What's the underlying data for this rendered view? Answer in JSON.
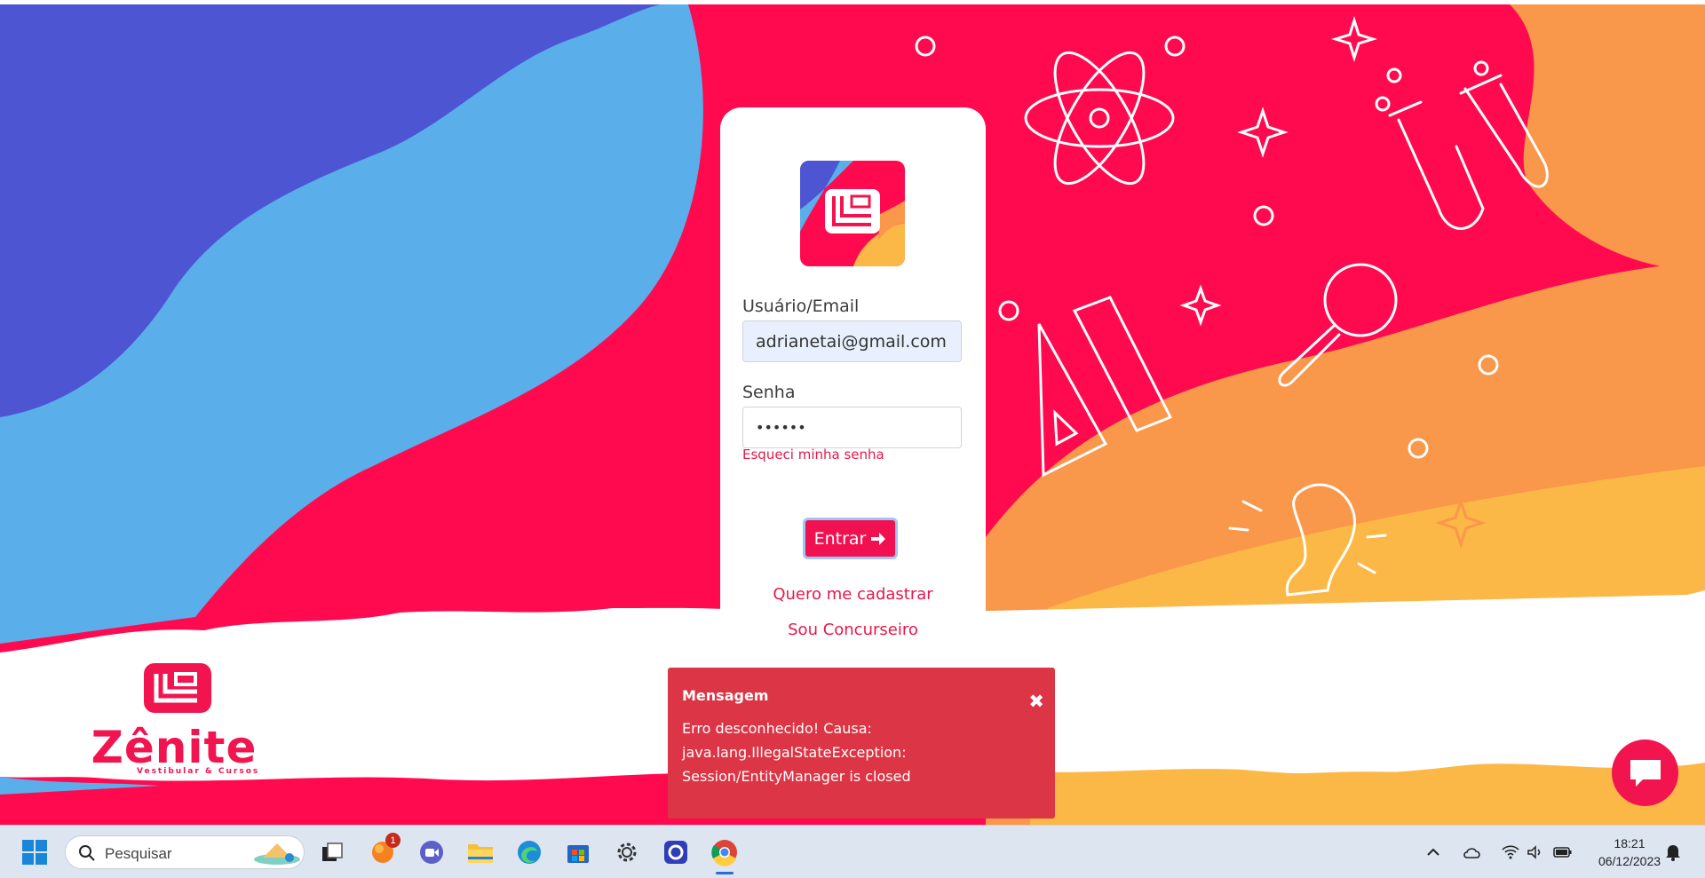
{
  "login": {
    "username_label": "Usuário/Email",
    "username_value": "adrianetai@gmail.com",
    "password_label": "Senha",
    "password_value": "••••••",
    "forgot_link": "Esqueci minha senha",
    "submit_label": "Entrar",
    "register_link": "Quero me cadastrar",
    "concurseiro_link": "Sou Concurseiro"
  },
  "brand": {
    "name": "Zênite",
    "tagline": "Vestibular & Cursos"
  },
  "toast": {
    "title": "Mensagem",
    "line1": "Erro desconhecido! Causa:",
    "line2": "java.lang.IllegalStateException:",
    "line3": "Session/EntityManager is closed",
    "close_icon": "✖"
  },
  "taskbar": {
    "search_placeholder": "Pesquisar",
    "notification_badge": "1",
    "time": "18:21",
    "date": "06/12/2023"
  },
  "colors": {
    "brand_red": "#f2144f",
    "indigo": "#4d55d3",
    "sky": "#5aaeea",
    "orange": "#f9974a",
    "yellow": "#fbb847",
    "toast_red": "#dc3545"
  }
}
